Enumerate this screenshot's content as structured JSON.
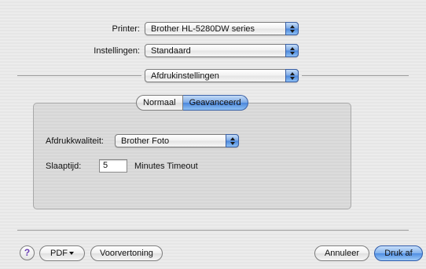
{
  "printer": {
    "label": "Printer:",
    "value": "Brother HL-5280DW series"
  },
  "presets": {
    "label": "Instellingen:",
    "value": "Standaard"
  },
  "panel_selector": {
    "value": "Afdrukinstellingen"
  },
  "tabs": [
    {
      "label": "Normaal",
      "selected": false
    },
    {
      "label": "Geavanceerd",
      "selected": true
    }
  ],
  "print_quality": {
    "label": "Afdrukkwaliteit:",
    "value": "Brother Foto"
  },
  "sleep_time": {
    "label": "Slaaptijd:",
    "value": "5",
    "unit": "Minutes Timeout"
  },
  "footer": {
    "help_icon": "?",
    "pdf_label": "PDF",
    "preview_label": "Voorvertoning",
    "cancel_label": "Annuleer",
    "print_label": "Druk af"
  },
  "colors": {
    "accent": "#4a86db",
    "help_icon": "#6a3fb5"
  }
}
